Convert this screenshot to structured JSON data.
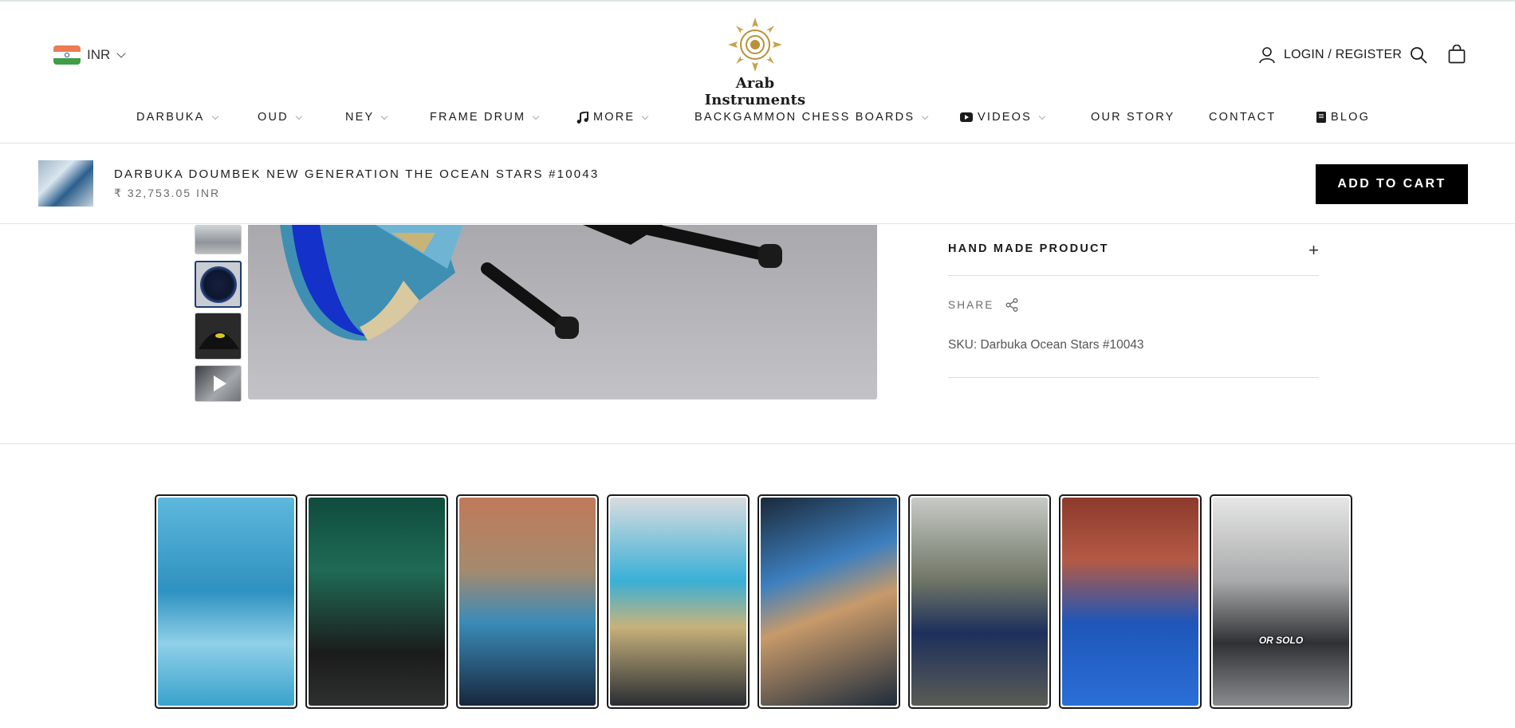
{
  "header": {
    "currency": {
      "code": "INR"
    },
    "logo_text": "Arab Instruments",
    "account_label": "LOGIN / REGISTER",
    "icons": {
      "account": "user-icon",
      "search": "search-icon",
      "cart": "bag-icon"
    }
  },
  "nav": {
    "items": [
      {
        "label": "DARBUKA",
        "has_dropdown": true
      },
      {
        "label": "OUD",
        "has_dropdown": true
      },
      {
        "label": "NEY",
        "has_dropdown": true
      },
      {
        "label": "FRAME DRUM",
        "has_dropdown": true
      },
      {
        "label": "MORE",
        "has_dropdown": true,
        "icon": "music-note-icon"
      },
      {
        "label": "BACKGAMMON CHESS BOARDS",
        "has_dropdown": true
      },
      {
        "label": "VIDEOS",
        "has_dropdown": true,
        "icon": "youtube-icon"
      },
      {
        "label": "OUR STORY",
        "has_dropdown": false
      },
      {
        "label": "CONTACT",
        "has_dropdown": false
      },
      {
        "label": "BLOG",
        "has_dropdown": false,
        "icon": "book-icon"
      }
    ]
  },
  "sticky_bar": {
    "title": "DARBUKA DOUMBEK NEW GENERATION THE OCEAN STARS #10043",
    "price": "₹ 32,753.05 INR",
    "add_to_cart_label": "ADD TO CART"
  },
  "product": {
    "accordion_title": "HAND MADE PRODUCT",
    "accordion_toggle": "+",
    "share_label": "SHARE",
    "sku": "SKU: Darbuka Ocean Stars #10043"
  },
  "reels": {
    "items": [
      {
        "caption": ""
      },
      {
        "caption": ""
      },
      {
        "caption": ""
      },
      {
        "caption": ""
      },
      {
        "caption": ""
      },
      {
        "caption": ""
      },
      {
        "caption": ""
      },
      {
        "caption": "OR SOLO"
      }
    ]
  },
  "colors": {
    "text": "#1c1b1b",
    "muted": "#6b6b6b",
    "button_bg": "#000000",
    "button_text": "#ffffff",
    "divider": "#e3e3e3"
  }
}
